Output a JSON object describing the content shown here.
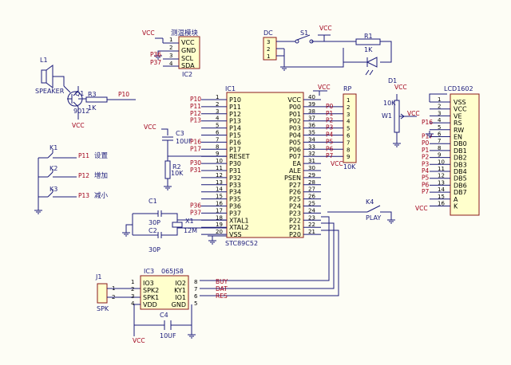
{
  "vcc": "VCC",
  "ic1": {
    "ref": "IC1",
    "part": "STC89C52",
    "left_pins": [
      {
        "n": "1",
        "name": "P10",
        "net": "P10"
      },
      {
        "n": "2",
        "name": "P11",
        "net": "P11"
      },
      {
        "n": "3",
        "name": "P12",
        "net": "P12"
      },
      {
        "n": "4",
        "name": "P13",
        "net": "P13"
      },
      {
        "n": "5",
        "name": "P14",
        "net": ""
      },
      {
        "n": "6",
        "name": "P15",
        "net": ""
      },
      {
        "n": "7",
        "name": "P16",
        "net": "P16"
      },
      {
        "n": "8",
        "name": "P17",
        "net": "P17"
      },
      {
        "n": "9",
        "name": "RESET",
        "net": ""
      },
      {
        "n": "10",
        "name": "P30",
        "net": "P30"
      },
      {
        "n": "11",
        "name": "P31",
        "net": "P31"
      },
      {
        "n": "12",
        "name": "P32",
        "net": ""
      },
      {
        "n": "13",
        "name": "P33",
        "net": ""
      },
      {
        "n": "14",
        "name": "P34",
        "net": ""
      },
      {
        "n": "15",
        "name": "P35",
        "net": ""
      },
      {
        "n": "16",
        "name": "P36",
        "net": "P36"
      },
      {
        "n": "17",
        "name": "P37",
        "net": "P37"
      },
      {
        "n": "18",
        "name": "XTAL1",
        "net": ""
      },
      {
        "n": "19",
        "name": "XTAL2",
        "net": ""
      },
      {
        "n": "20",
        "name": "VSS",
        "net": ""
      }
    ],
    "right_pins": [
      {
        "n": "40",
        "name": "VCC",
        "net": ""
      },
      {
        "n": "39",
        "name": "P00",
        "net": "P0"
      },
      {
        "n": "38",
        "name": "P01",
        "net": "P1"
      },
      {
        "n": "37",
        "name": "P02",
        "net": "P2"
      },
      {
        "n": "36",
        "name": "P03",
        "net": "P3"
      },
      {
        "n": "35",
        "name": "P04",
        "net": "P4"
      },
      {
        "n": "34",
        "name": "P05",
        "net": "P5"
      },
      {
        "n": "33",
        "name": "P06",
        "net": "P6"
      },
      {
        "n": "32",
        "name": "P07",
        "net": "P7"
      },
      {
        "n": "31",
        "name": "EA",
        "net": ""
      },
      {
        "n": "30",
        "name": "ALE",
        "net": ""
      },
      {
        "n": "29",
        "name": "PSEN",
        "net": ""
      },
      {
        "n": "28",
        "name": "P27",
        "net": ""
      },
      {
        "n": "27",
        "name": "P26",
        "net": ""
      },
      {
        "n": "26",
        "name": "P25",
        "net": ""
      },
      {
        "n": "25",
        "name": "P24",
        "net": ""
      },
      {
        "n": "24",
        "name": "P23",
        "net": ""
      },
      {
        "n": "23",
        "name": "P22",
        "net": ""
      },
      {
        "n": "22",
        "name": "P21",
        "net": ""
      },
      {
        "n": "21",
        "name": "P20",
        "net": ""
      }
    ]
  },
  "ic2": {
    "ref": "IC2",
    "title": "测温模块",
    "pins": [
      {
        "n": "1",
        "name": "VCC",
        "net": ""
      },
      {
        "n": "2",
        "name": "GND",
        "net": ""
      },
      {
        "n": "3",
        "name": "SCL",
        "net": "P36"
      },
      {
        "n": "4",
        "name": "SDA",
        "net": "P37"
      }
    ]
  },
  "ic3": {
    "ref": "IC3",
    "part": "065JS8",
    "left_pins": [
      {
        "n": "1",
        "name": "IO3"
      },
      {
        "n": "2",
        "name": "SPK2"
      },
      {
        "n": "3",
        "name": "SPK1"
      },
      {
        "n": "4",
        "name": "VDD"
      }
    ],
    "right_pins": [
      {
        "n": "8",
        "name": "IO2",
        "net": "BUY"
      },
      {
        "n": "7",
        "name": "KY1",
        "net": "DAT"
      },
      {
        "n": "6",
        "name": "IO1",
        "net": "RES"
      },
      {
        "n": "5",
        "name": "GND",
        "net": ""
      }
    ]
  },
  "rp": {
    "ref": "RP",
    "value": "10K",
    "pins": [
      "1",
      "2",
      "3",
      "4",
      "5",
      "6",
      "7",
      "8",
      "9"
    ]
  },
  "lcd": {
    "ref": "LCD1602",
    "pins": [
      {
        "n": "1",
        "name": "VSS",
        "net": ""
      },
      {
        "n": "2",
        "name": "VCC",
        "net": ""
      },
      {
        "n": "3",
        "name": "VE",
        "net": ""
      },
      {
        "n": "4",
        "name": "RS",
        "net": "P16"
      },
      {
        "n": "5",
        "name": "RW",
        "net": ""
      },
      {
        "n": "6",
        "name": "EN",
        "net": "P17"
      },
      {
        "n": "7",
        "name": "DB0",
        "net": "P0"
      },
      {
        "n": "8",
        "name": "DB1",
        "net": "P1"
      },
      {
        "n": "9",
        "name": "DB2",
        "net": "P2"
      },
      {
        "n": "10",
        "name": "DB3",
        "net": "P3"
      },
      {
        "n": "11",
        "name": "DB4",
        "net": "P4"
      },
      {
        "n": "12",
        "name": "DB5",
        "net": "P5"
      },
      {
        "n": "13",
        "name": "DB6",
        "net": "P6"
      },
      {
        "n": "14",
        "name": "DB7",
        "net": "P7"
      },
      {
        "n": "15",
        "name": "A",
        "net": ""
      },
      {
        "n": "16",
        "name": "K",
        "net": ""
      }
    ]
  },
  "speaker": {
    "ref": "L1",
    "label": "SPEAKER"
  },
  "q1": {
    "ref": "Q1",
    "part": "9012"
  },
  "r3": {
    "ref": "R3",
    "value": "1K",
    "net": "P10"
  },
  "keys": [
    {
      "ref": "K1",
      "net": "P11",
      "label": "设置"
    },
    {
      "ref": "K2",
      "net": "P12",
      "label": "增加"
    },
    {
      "ref": "K3",
      "net": "P13",
      "label": "减小"
    }
  ],
  "c3": {
    "ref": "C3",
    "value": "10UF"
  },
  "r2": {
    "ref": "R2",
    "value": "10K"
  },
  "c1": {
    "ref": "C1",
    "value": "30P"
  },
  "c2": {
    "ref": "C2",
    "value": "30P"
  },
  "x1": {
    "ref": "X1",
    "value": "12M"
  },
  "dc": {
    "ref": "DC",
    "pins": [
      "3",
      "2",
      "1"
    ]
  },
  "s1": {
    "ref": "S1"
  },
  "r1": {
    "ref": "R1",
    "value": "1K"
  },
  "d1": {
    "ref": "D1"
  },
  "w1": {
    "ref": "W1",
    "value": "10K"
  },
  "k4": {
    "ref": "K4",
    "label": "PLAY"
  },
  "j1": {
    "ref": "J1",
    "label": "SPK",
    "pins": [
      "1",
      "2"
    ]
  },
  "c4": {
    "ref": "C4",
    "value": "10UF"
  }
}
